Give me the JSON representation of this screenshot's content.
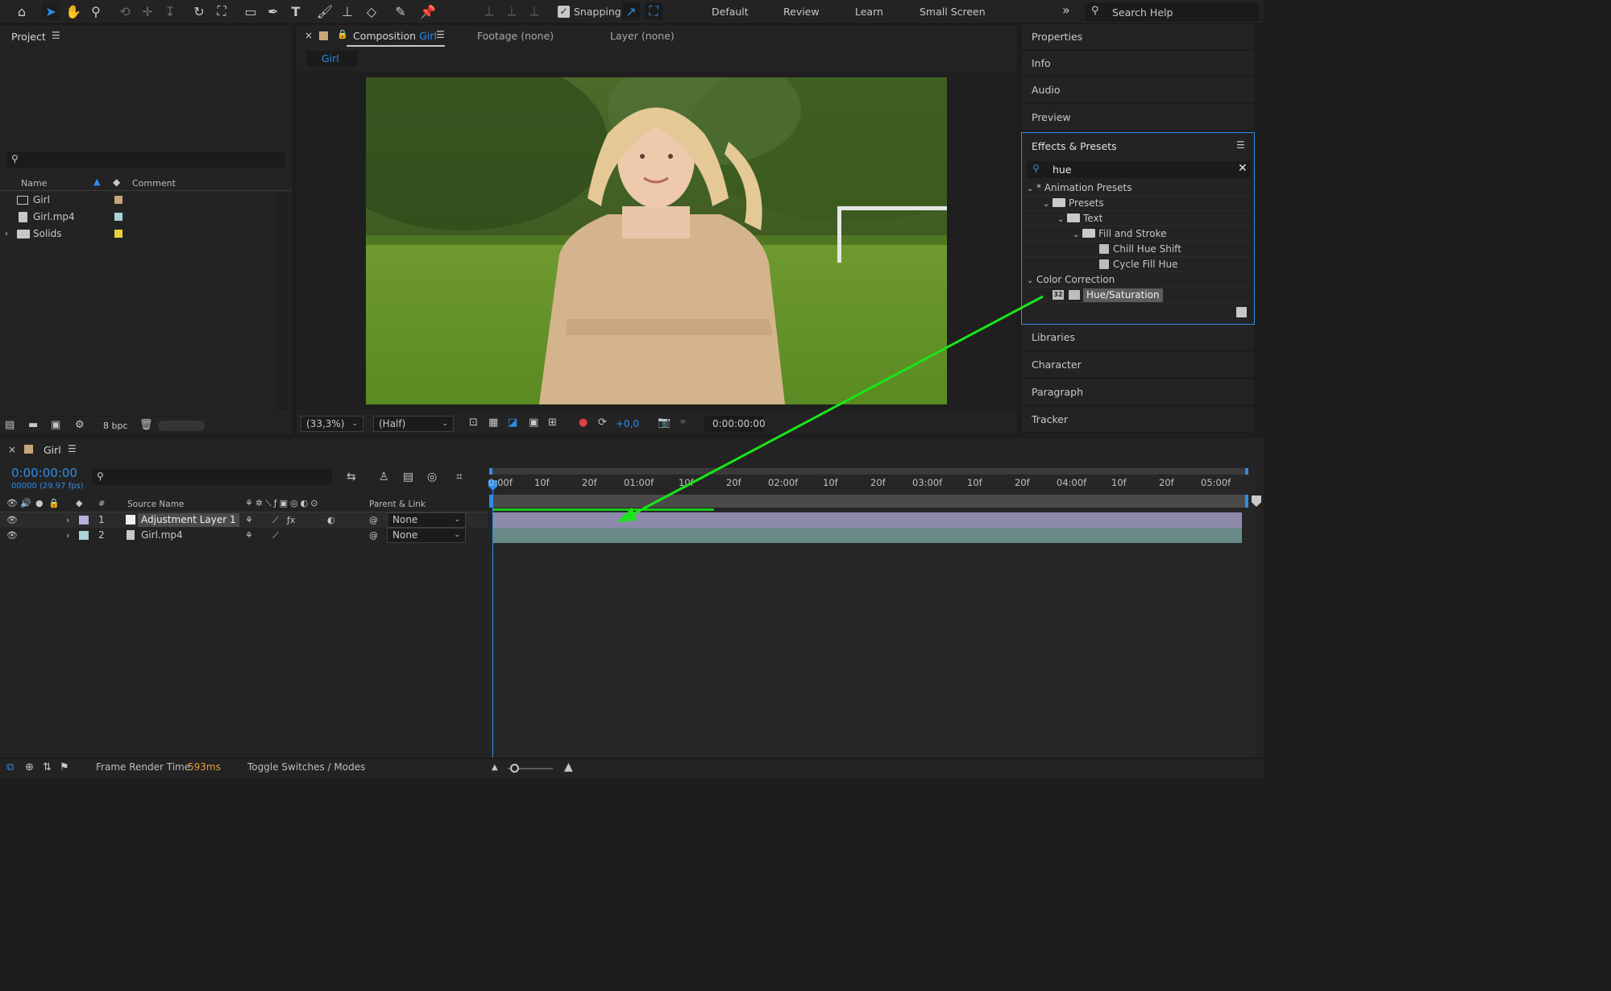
{
  "toolbar": {
    "snapping_label": "Snapping",
    "workspaces": [
      "Default",
      "Review",
      "Learn",
      "Small Screen"
    ],
    "more": "»",
    "search_placeholder": "Search Help"
  },
  "project": {
    "title": "Project",
    "columns": {
      "name": "Name",
      "comment": "Comment"
    },
    "items": [
      {
        "name": "Girl",
        "color": "#c8a67c"
      },
      {
        "name": "Girl.mp4",
        "color": "#a8d4d6"
      },
      {
        "name": "Solids",
        "color": "#e6d23a"
      }
    ],
    "bpc": "8 bpc"
  },
  "viewer": {
    "tabs": {
      "comp_prefix": "Composition",
      "comp_name": "Girl",
      "footage": "Footage (none)",
      "layer": "Layer (none)"
    },
    "breadcrumb": "Girl",
    "zoom": "(33,3%)",
    "resolution": "(Half)",
    "exposure": "+0,0",
    "timecode": "0:00:00:00"
  },
  "right_panel": {
    "tabs_top": [
      "Properties",
      "Info",
      "Audio",
      "Preview"
    ],
    "effects_title": "Effects & Presets",
    "search_value": "hue",
    "tree": {
      "animation_presets": "* Animation Presets",
      "presets": "Presets",
      "text": "Text",
      "fill_and_stroke": "Fill and Stroke",
      "chill_hue_shift": "Chill Hue Shift",
      "cycle_fill_hue": "Cycle Fill Hue",
      "color_correction": "Color Correction",
      "hue_saturation": "Hue/Saturation",
      "bit_depth": "32"
    },
    "tabs_bottom": [
      "Libraries",
      "Character",
      "Paragraph",
      "Tracker"
    ]
  },
  "timeline": {
    "comp_name": "Girl",
    "timecode": "0:00:00:00",
    "frames_fps": "00000 (29.97 fps)",
    "headers": {
      "number": "#",
      "source_name": "Source Name",
      "parent": "Parent & Link"
    },
    "layers": [
      {
        "num": "1",
        "name": "Adjustment Layer 1",
        "color": "#b4b0dc",
        "parent": "None"
      },
      {
        "num": "2",
        "name": "Girl.mp4",
        "color": "#a8d4d6",
        "parent": "None"
      }
    ],
    "ruler": [
      "0:00f",
      "10f",
      "20f",
      "01:00f",
      "10f",
      "20f",
      "02:00f",
      "10f",
      "20f",
      "03:00f",
      "10f",
      "20f",
      "04:00f",
      "10f",
      "20f",
      "05:00f"
    ]
  },
  "status": {
    "frame_render_label": "Frame Render Time",
    "frame_render_value": "593ms",
    "toggle": "Toggle Switches / Modes"
  },
  "colors": {
    "accent_blue": "#2d8ceb",
    "arrow_green": "#19e619",
    "render_orange": "#e89a3c"
  }
}
